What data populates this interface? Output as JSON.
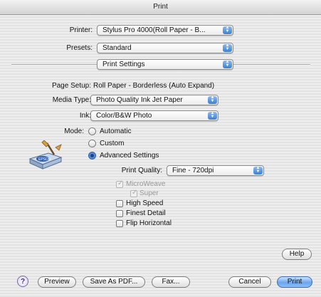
{
  "window": {
    "title": "Print"
  },
  "printer": {
    "label": "Printer:",
    "value": "Stylus Pro 4000(Roll Paper - B..."
  },
  "presets": {
    "label": "Presets:",
    "value": "Standard"
  },
  "panel": {
    "value": "Print Settings"
  },
  "page_setup": {
    "label": "Page Setup:",
    "value": "Roll Paper - Borderless (Auto Expand)"
  },
  "media_type": {
    "label": "Media Type:",
    "value": "Photo Quality Ink Jet Paper"
  },
  "ink": {
    "label": "Ink:",
    "value": "Color/B&W Photo"
  },
  "mode": {
    "label": "Mode:",
    "options": [
      "Automatic",
      "Custom",
      "Advanced Settings"
    ],
    "selected": "Advanced Settings"
  },
  "print_quality": {
    "label": "Print Quality:",
    "value": "Fine - 720dpi"
  },
  "options": {
    "microweave": "MicroWeave",
    "super": "Super",
    "high_speed": "High Speed",
    "finest_detail": "Finest Detail",
    "flip_horizontal": "Flip Horizontal"
  },
  "buttons": {
    "help": "Help",
    "help_circle": "?",
    "preview": "Preview",
    "save_pdf": "Save As PDF...",
    "fax": "Fax...",
    "cancel": "Cancel",
    "print": "Print"
  },
  "icons": {
    "mode_icon": "epson-printer-brush-icon",
    "popup_arrow": "updown-arrows-icon"
  }
}
